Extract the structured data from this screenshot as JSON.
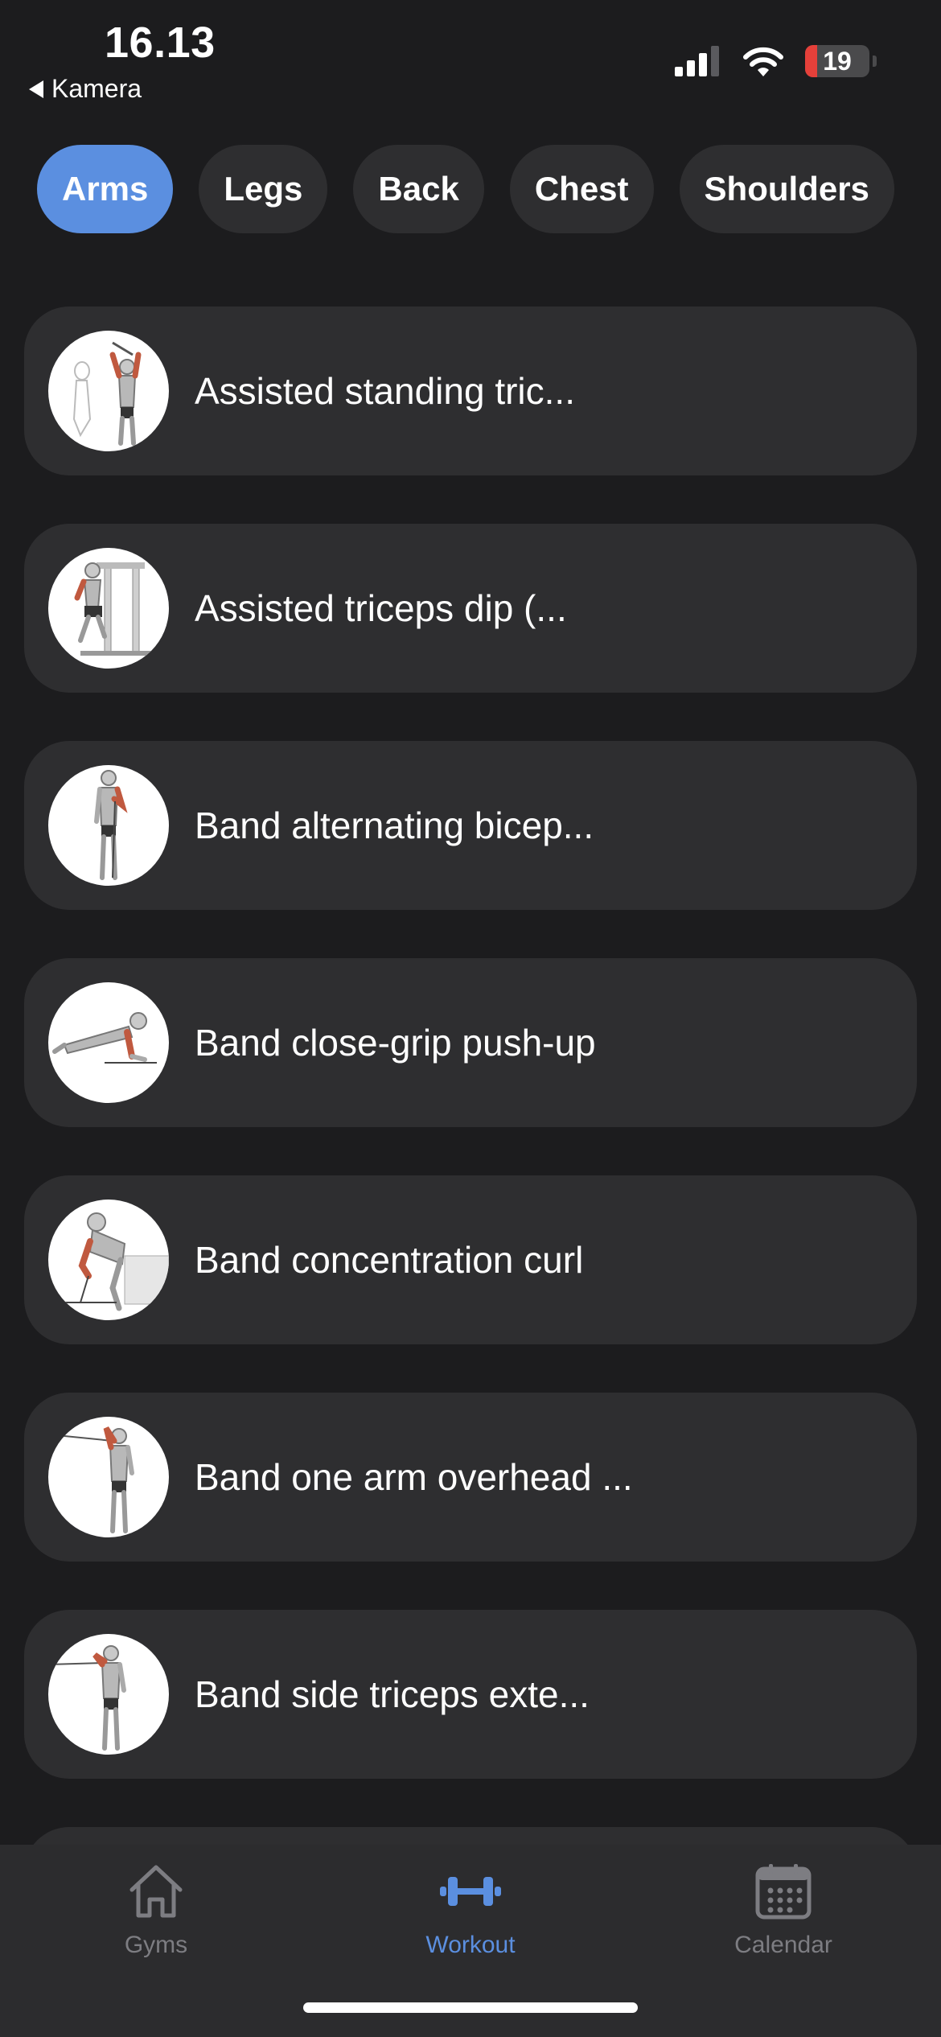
{
  "status_bar": {
    "time": "16.13",
    "back_label": "Kamera",
    "battery_level": "19",
    "icons": [
      "cellular-signal-icon",
      "wifi-icon",
      "battery-icon"
    ]
  },
  "categories": [
    {
      "label": "Arms",
      "active": true
    },
    {
      "label": "Legs",
      "active": false
    },
    {
      "label": "Back",
      "active": false
    },
    {
      "label": "Chest",
      "active": false
    },
    {
      "label": "Shoulders",
      "active": false
    }
  ],
  "exercises": [
    {
      "name": "Assisted standing tric...",
      "thumb_icon": "triceps-exercise-illustration"
    },
    {
      "name": "Assisted triceps dip (...",
      "thumb_icon": "triceps-dip-machine-illustration"
    },
    {
      "name": "Band alternating bicep...",
      "thumb_icon": "biceps-curl-illustration"
    },
    {
      "name": "Band close-grip push-up",
      "thumb_icon": "push-up-illustration"
    },
    {
      "name": "Band concentration curl",
      "thumb_icon": "concentration-curl-illustration"
    },
    {
      "name": "Band one arm overhead ...",
      "thumb_icon": "overhead-extension-illustration"
    },
    {
      "name": "Band side triceps exte...",
      "thumb_icon": "side-triceps-extension-illustration"
    }
  ],
  "tabbar": {
    "tabs": [
      {
        "label": "Gyms",
        "icon": "house-icon",
        "active": false
      },
      {
        "label": "Workout",
        "icon": "dumbbell-icon",
        "active": true
      },
      {
        "label": "Calendar",
        "icon": "calendar-icon",
        "active": false
      }
    ]
  },
  "colors": {
    "background": "#1c1c1e",
    "card": "#2e2e30",
    "accent": "#5b8fe0",
    "inactive_tab": "#7d7d82",
    "battery_low": "#e5403a"
  }
}
